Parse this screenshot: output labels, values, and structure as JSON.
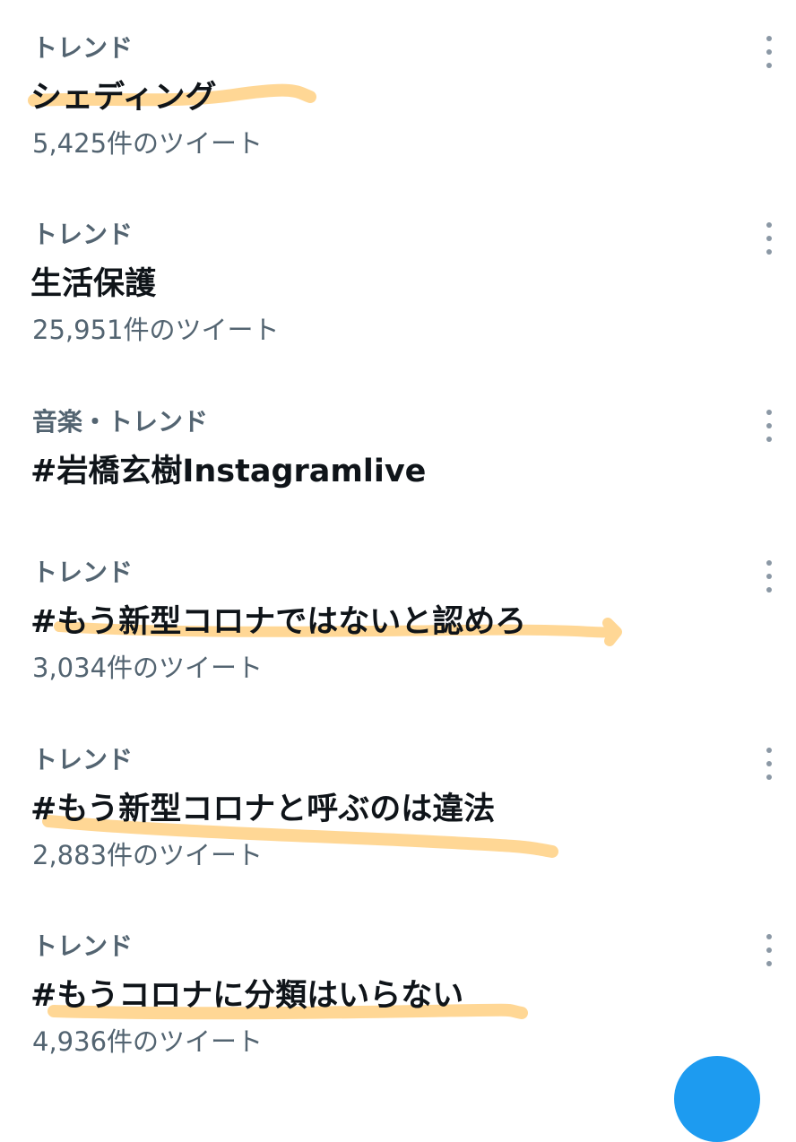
{
  "trends": [
    {
      "category": "トレンド",
      "name": "シェディング",
      "count": "5,425件のツイート"
    },
    {
      "category": "トレンド",
      "name": "生活保護",
      "count": "25,951件のツイート"
    },
    {
      "category": "音楽・トレンド",
      "name": "#岩橋玄樹Instagramlive",
      "count": ""
    },
    {
      "category": "トレンド",
      "name": "#もう新型コロナではないと認めろ",
      "count": "3,034件のツイート"
    },
    {
      "category": "トレンド",
      "name": "#もう新型コロナと呼ぶのは違法",
      "count": "2,883件のツイート"
    },
    {
      "category": "トレンド",
      "name": "#もうコロナに分類はいらない",
      "count": "4,936件のツイート"
    }
  ],
  "highlight_color": "#ffd38a",
  "accent_color": "#1d9bf0",
  "icons": {
    "more": "more-vertical-icon",
    "compose": "compose-fab"
  }
}
